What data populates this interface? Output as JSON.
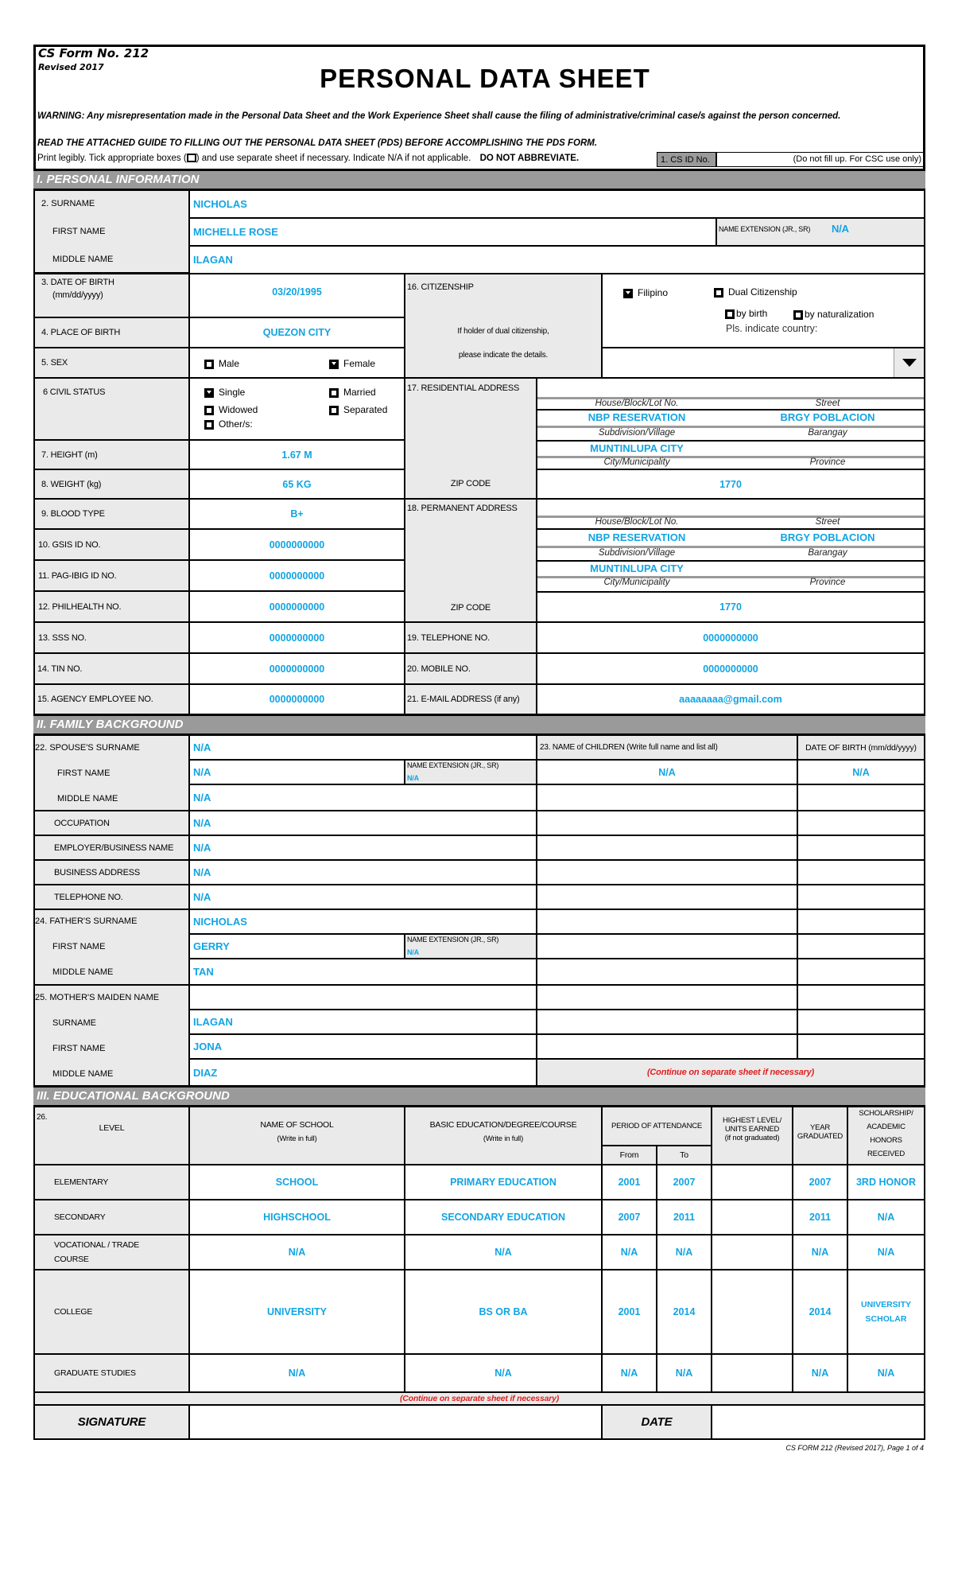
{
  "header": {
    "form_no": "CS Form No. 212",
    "revised": "Revised 2017",
    "title": "PERSONAL DATA SHEET",
    "warning": "WARNING: Any misrepresentation made in the Personal Data Sheet and the Work Experience Sheet shall cause the filing of administrative/criminal case/s against the person concerned.",
    "read_guide": "READ THE ATTACHED GUIDE TO FILLING OUT THE PERSONAL DATA SHEET (PDS) BEFORE ACCOMPLISHING THE PDS FORM.",
    "instructions_a": "Print legibly. Tick appropriate boxes (",
    "instructions_b": ") and use separate sheet if necessary. Indicate N/A if not applicable.",
    "do_not_abbreviate": "DO NOT ABBREVIATE.",
    "cs_id_label": "1. CS ID No.",
    "cs_id_note": "(Do not fill up. For CSC use only)"
  },
  "personal": {
    "section_title": "I. PERSONAL INFORMATION",
    "surname_label": "2.  SURNAME",
    "surname": "NICHOLAS",
    "first_name_label": "FIRST NAME",
    "first_name": "MICHELLE ROSE",
    "name_ext_label": "NAME EXTENSION (JR., SR)",
    "name_ext": "N/A",
    "middle_name_label": "MIDDLE NAME",
    "middle_name": "ILAGAN",
    "dob_label": "3.  DATE OF BIRTH",
    "dob_format": "(mm/dd/yyyy)",
    "dob": "03/20/1995",
    "pob_label": "4.  PLACE OF BIRTH",
    "pob": "QUEZON CITY",
    "sex_label": "5.  SEX",
    "sex_options": [
      "Male",
      "Female"
    ],
    "sex_selected": "Female",
    "civil_label": "6  CIVIL STATUS",
    "civil_options": [
      "Single",
      "Married",
      "Widowed",
      "Separated",
      "Other/s:"
    ],
    "civil_selected": "Single",
    "height_label": "7.  HEIGHT (m)",
    "height": "1.67 M",
    "weight_label": "8.  WEIGHT (kg)",
    "weight": "65 KG",
    "blood_label": "9.  BLOOD TYPE",
    "blood": "B+",
    "gsis_label": "10.  GSIS ID NO.",
    "gsis": "0000000000",
    "pagibig_label": "11.  PAG-IBIG ID NO.",
    "pagibig": "0000000000",
    "philhealth_label": "12.  PHILHEALTH NO.",
    "philhealth": "0000000000",
    "sss_label": "13.  SSS NO.",
    "sss": "0000000000",
    "tin_label": "14. TIN NO.",
    "tin": "0000000000",
    "agency_label": "15. AGENCY EMPLOYEE NO.",
    "agency": "0000000000",
    "citizenship_label": "16. CITIZENSHIP",
    "citizenship_note1": "If holder of  dual citizenship,",
    "citizenship_note2": "please indicate the details.",
    "citizenship_filipino": "Filipino",
    "citizenship_dual": "Dual Citizenship",
    "citizenship_by_birth": "by birth",
    "citizenship_by_nat": "by naturalization",
    "citizenship_country_prompt": "Pls. indicate country:",
    "citizenship_selected": "Filipino",
    "country_value": "",
    "res_label": "17. RESIDENTIAL ADDRESS",
    "perm_label": "18. PERMANENT ADDRESS",
    "zip_label": "ZIP CODE",
    "addr_sublabels": {
      "house": "House/Block/Lot No.",
      "street": "Street",
      "subdivision": "Subdivision/Village",
      "barangay": "Barangay",
      "city": "City/Municipality",
      "province": "Province"
    },
    "residential": {
      "house": "",
      "street": "",
      "subdivision": "NBP RESERVATION",
      "barangay": "BRGY POBLACION",
      "city": "MUNTINLUPA CITY",
      "province": "",
      "zip": "1770"
    },
    "permanent": {
      "house": "",
      "street": "",
      "subdivision": "NBP RESERVATION",
      "barangay": "BRGY POBLACION",
      "city": "MUNTINLUPA CITY",
      "province": "",
      "zip": "1770"
    },
    "tel_label": "19. TELEPHONE NO.",
    "tel": "0000000000",
    "mobile_label": "20. MOBILE NO.",
    "mobile": "0000000000",
    "email_label": "21. E-MAIL ADDRESS (if any)",
    "email": "aaaaaaaa@gmail.com"
  },
  "family": {
    "section_title": "II.  FAMILY BACKGROUND",
    "spouse_surname_label": "22.  SPOUSE'S SURNAME",
    "spouse_surname": "N/A",
    "spouse_first_label": "FIRST NAME",
    "spouse_first": "N/A",
    "spouse_ext_label": "NAME EXTENSION (JR., SR)",
    "spouse_ext": "N/A",
    "spouse_middle_label": "MIDDLE NAME",
    "spouse_middle": "N/A",
    "occupation_label": "OCCUPATION",
    "occupation": "N/A",
    "employer_label": "EMPLOYER/BUSINESS NAME",
    "employer": "N/A",
    "business_addr_label": "BUSINESS ADDRESS",
    "business_addr": "N/A",
    "telephone_label": "TELEPHONE NO.",
    "telephone": "N/A",
    "father_surname_label": "24.   FATHER'S SURNAME",
    "father_surname": "NICHOLAS",
    "father_first_label": "FIRST NAME",
    "father_first": "GERRY",
    "father_ext_label": "NAME EXTENSION (JR., SR)",
    "father_ext": "N/A",
    "father_middle_label": "MIDDLE NAME",
    "father_middle": "TAN",
    "mother_label": "25.  MOTHER'S MAIDEN NAME",
    "mother_surname_label": "SURNAME",
    "mother_surname": "ILAGAN",
    "mother_first_label": "FIRST NAME",
    "mother_first": "JONA",
    "mother_middle_label": "MIDDLE NAME",
    "mother_middle": "DIAZ",
    "children_label": "23. NAME of CHILDREN  (Write full name and list all)",
    "children_dob_label": "DATE OF BIRTH (mm/dd/yyyy)",
    "children": [
      {
        "name": "N/A",
        "dob": "N/A"
      }
    ],
    "continue_note": "(Continue on separate sheet if necessary)"
  },
  "education": {
    "section_title": "III.  EDUCATIONAL BACKGROUND",
    "headers": {
      "num": "26.",
      "level": "LEVEL",
      "school": "NAME OF SCHOOL",
      "school_sub": "(Write in full)",
      "course": "BASIC EDUCATION/DEGREE/COURSE",
      "course_sub": "(Write in full)",
      "period": "PERIOD OF ATTENDANCE",
      "from": "From",
      "to": "To",
      "highest": "HIGHEST LEVEL/ UNITS EARNED",
      "highest_sub": "(if not graduated)",
      "year": "YEAR GRADUATED",
      "honors": "SCHOLARSHIP/ ACADEMIC HONORS RECEIVED"
    },
    "rows": [
      {
        "level": "ELEMENTARY",
        "school": "SCHOOL",
        "course": "PRIMARY EDUCATION",
        "from": "2001",
        "to": "2007",
        "highest": "",
        "year": "2007",
        "honors": "3RD HONOR"
      },
      {
        "level": "SECONDARY",
        "school": "HIGHSCHOOL",
        "course": "SECONDARY EDUCATION",
        "from": "2007",
        "to": "2011",
        "highest": "",
        "year": "2011",
        "honors": "N/A"
      },
      {
        "level": "VOCATIONAL / TRADE COURSE",
        "school": "N/A",
        "course": "N/A",
        "from": "N/A",
        "to": "N/A",
        "highest": "",
        "year": "N/A",
        "honors": "N/A"
      },
      {
        "level": "COLLEGE",
        "school": "UNIVERSITY",
        "course": "BS OR BA",
        "from": "2001",
        "to": "2014",
        "highest": "",
        "year": "2014",
        "honors": "UNIVERSITY SCHOLAR"
      },
      {
        "level": "GRADUATE STUDIES",
        "school": "N/A",
        "course": "N/A",
        "from": "N/A",
        "to": "N/A",
        "highest": "",
        "year": "N/A",
        "honors": "N/A"
      }
    ],
    "continue_note": "(Continue on separate sheet if necessary)"
  },
  "signature": {
    "signature_label": "SIGNATURE",
    "date_label": "DATE"
  },
  "footer": {
    "page_note": "CS FORM 212 (Revised 2017), Page 1 of 4"
  }
}
